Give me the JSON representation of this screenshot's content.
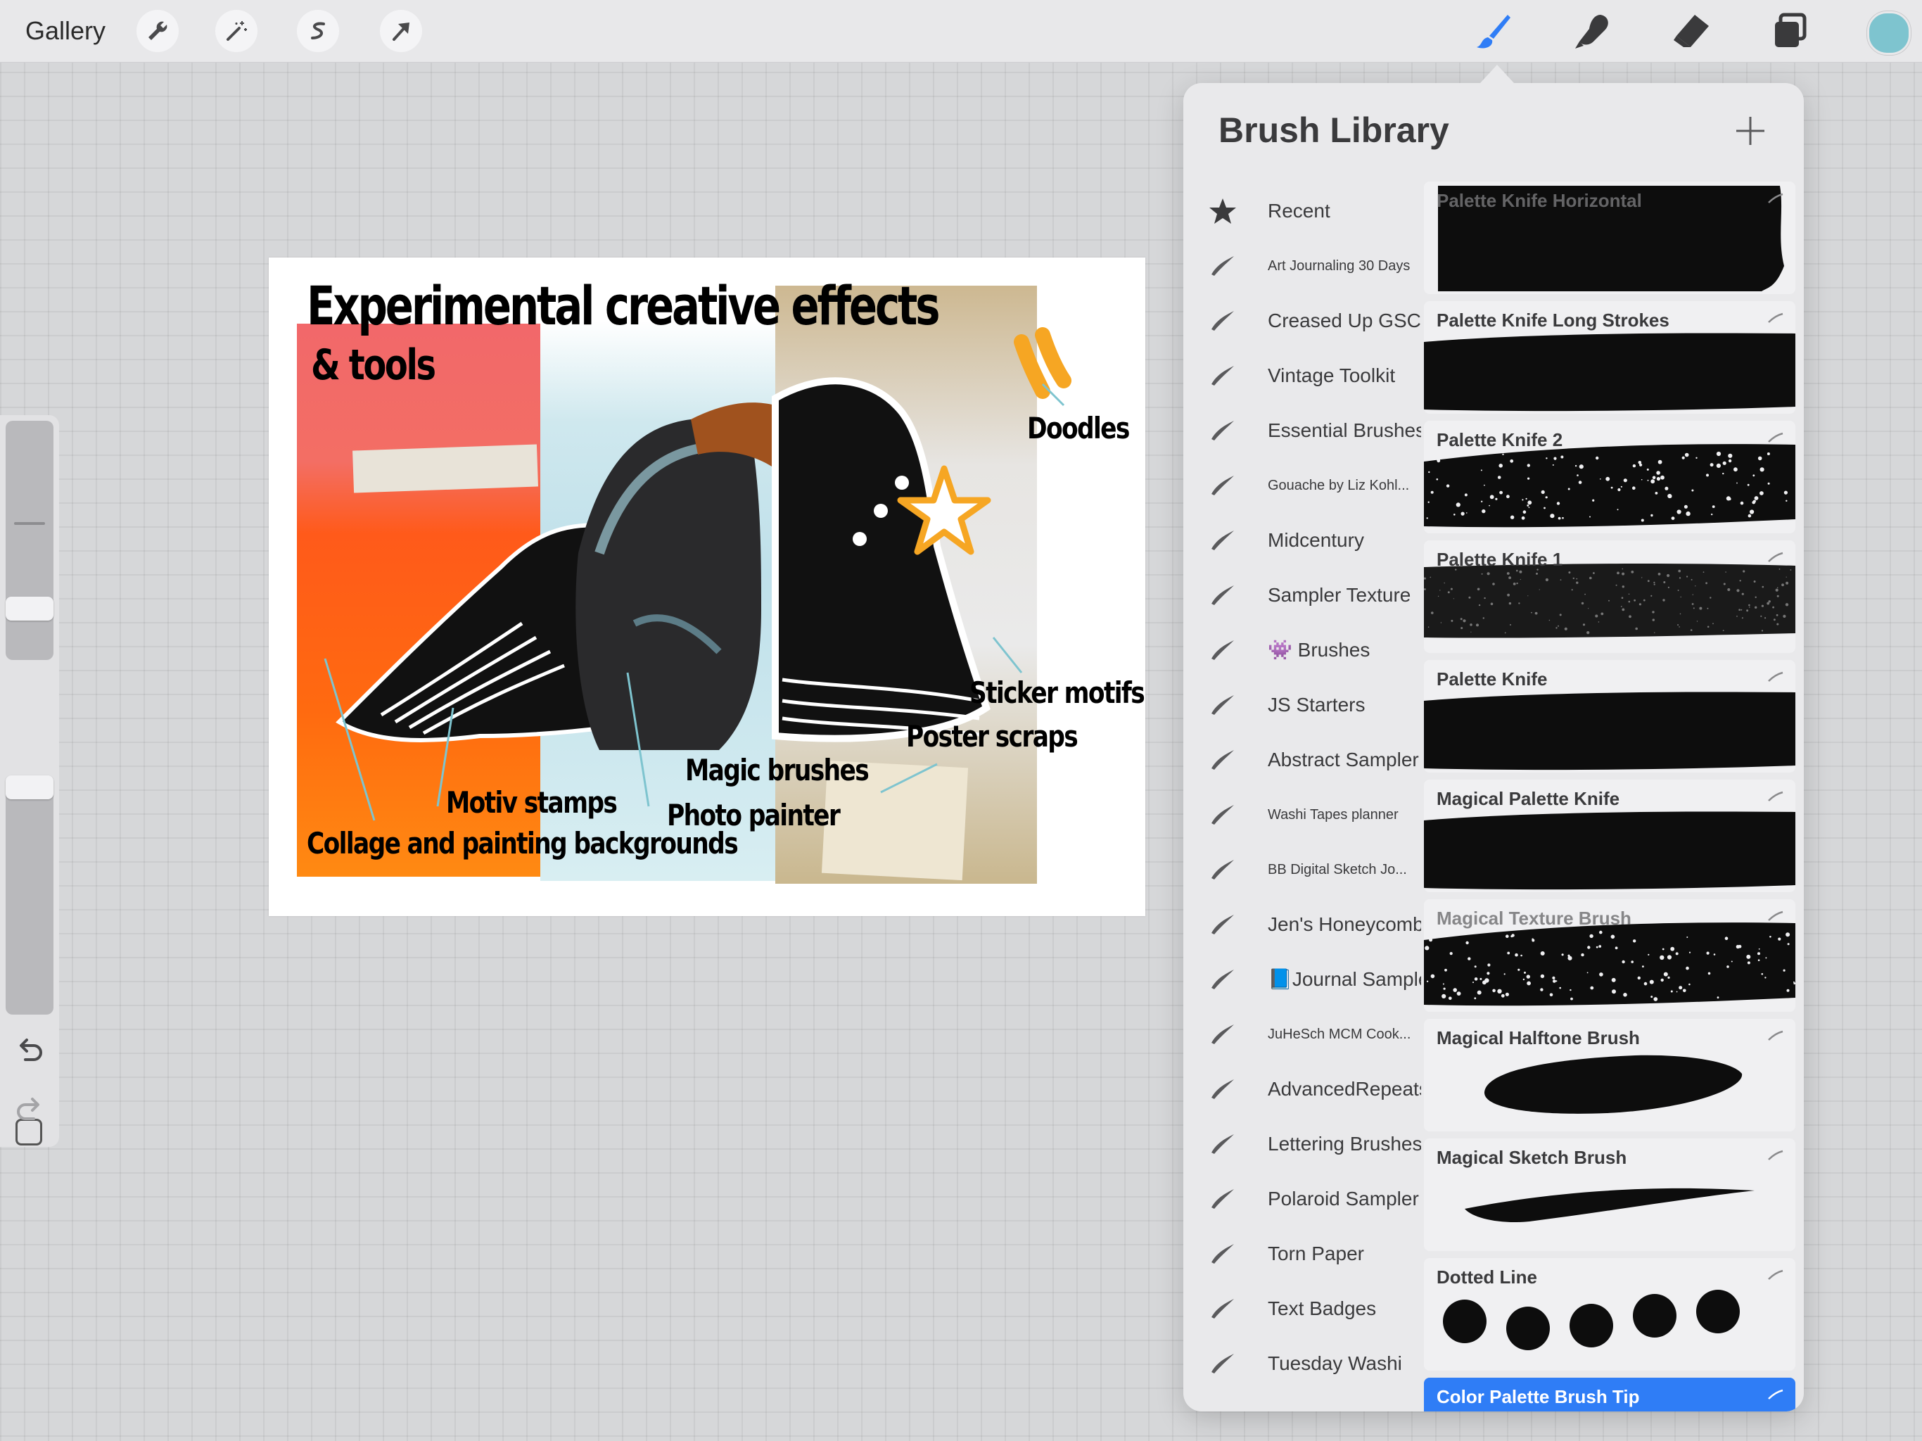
{
  "toolbar": {
    "gallery_label": "Gallery",
    "left_tools": [
      "wrench-icon",
      "magic-wand-icon",
      "selection-icon",
      "transform-arrow-icon"
    ],
    "right_tools": [
      "brush-icon",
      "smudge-icon",
      "eraser-icon",
      "layers-icon"
    ],
    "active_tool": "brush-icon",
    "current_color": "#7ec4cf"
  },
  "canvas": {
    "title": "Experimental creative effects",
    "subtitle": "& tools",
    "labels": {
      "doodles": "Doodles",
      "sticker_motifs": "Sticker motifs",
      "poster_scraps": "Poster scraps",
      "magic_brushes": "Magic brushes",
      "photo_painter": "Photo painter",
      "motiv_stamps": "Motiv stamps",
      "collage": "Collage and painting backgrounds"
    }
  },
  "brush_library": {
    "title": "Brush Library",
    "sets": [
      {
        "label": "Recent",
        "icon": "star-icon"
      },
      {
        "label": "Art Journaling 30 Days",
        "icon": "brush-stroke-icon",
        "small": true
      },
      {
        "label": "Creased Up GSC",
        "icon": "brush-stroke-icon"
      },
      {
        "label": "Vintage Toolkit",
        "icon": "brush-stroke-icon"
      },
      {
        "label": "Essential Brushes",
        "icon": "brush-stroke-icon"
      },
      {
        "label": "Gouache by Liz Kohl...",
        "icon": "brush-stroke-icon",
        "small": true
      },
      {
        "label": "Midcentury",
        "icon": "brush-stroke-icon"
      },
      {
        "label": "Sampler Texture",
        "icon": "brush-stroke-icon"
      },
      {
        "label": "👾 Brushes",
        "icon": "brush-stroke-icon"
      },
      {
        "label": "JS Starters",
        "icon": "brush-stroke-icon"
      },
      {
        "label": "Abstract Sampler",
        "icon": "brush-stroke-icon"
      },
      {
        "label": "Washi Tapes planner",
        "icon": "brush-stroke-icon",
        "small": true
      },
      {
        "label": "BB Digital Sketch Jo...",
        "icon": "brush-stroke-icon",
        "small": true
      },
      {
        "label": "Jen's Honeycomb",
        "icon": "brush-stroke-icon"
      },
      {
        "label": "📘Journal Sampler",
        "icon": "brush-stroke-icon"
      },
      {
        "label": "JuHeSch MCM Cook...",
        "icon": "brush-stroke-icon",
        "small": true
      },
      {
        "label": "AdvancedRepeats",
        "icon": "brush-stroke-icon"
      },
      {
        "label": "Lettering Brushes",
        "icon": "brush-stroke-icon"
      },
      {
        "label": "Polaroid Sampler",
        "icon": "brush-stroke-icon"
      },
      {
        "label": "Torn Paper",
        "icon": "brush-stroke-icon"
      },
      {
        "label": "Text Badges",
        "icon": "brush-stroke-icon"
      },
      {
        "label": "Tuesday Washi",
        "icon": "brush-stroke-icon"
      }
    ],
    "brushes": [
      {
        "name": "Palette Knife Horizontal",
        "style": "block"
      },
      {
        "name": "Palette Knife Long Strokes",
        "style": "band"
      },
      {
        "name": "Palette Knife 2",
        "style": "speckle"
      },
      {
        "name": "Palette Knife 1",
        "style": "grain"
      },
      {
        "name": "Palette Knife",
        "style": "band"
      },
      {
        "name": "Magical Palette Knife",
        "style": "band"
      },
      {
        "name": "Magical Texture Brush",
        "style": "speckle"
      },
      {
        "name": "Magical Halftone Brush",
        "style": "oval"
      },
      {
        "name": "Magical Sketch Brush",
        "style": "taper"
      },
      {
        "name": "Dotted Line",
        "style": "dots"
      },
      {
        "name": "Color Palette Brush Tip",
        "style": "active"
      }
    ]
  }
}
